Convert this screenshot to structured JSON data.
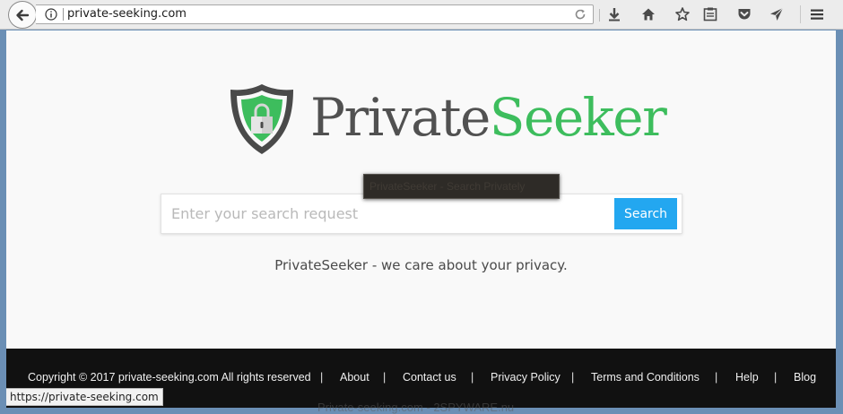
{
  "browser": {
    "url": "private-seeking.com",
    "toolbar_icons": [
      "download-icon",
      "home-icon",
      "bookmark-star-icon",
      "reader-view-icon",
      "pocket-icon",
      "send-icon",
      "menu-icon"
    ]
  },
  "logo": {
    "text_part1": "Private",
    "text_part2": "Seeker",
    "colors": {
      "shield_outline": "#4a4a4a",
      "shield_fill": "#3dbd5d",
      "private": "#515151",
      "seeker": "#3dbd5d"
    }
  },
  "tooltip": {
    "text": "PrivateSeeker - Search Privately"
  },
  "search": {
    "placeholder": "Enter your search request",
    "value": "",
    "button_label": "Search",
    "button_color": "#23a7f0"
  },
  "tagline": "PrivateSeeker - we care about your privacy.",
  "footer": {
    "copyright": "Copyright © 2017 private-seeking.com All rights reserved",
    "separator": "|",
    "links": [
      "About",
      "Contact us",
      "Privacy Policy",
      "Terms and Conditions",
      "Help",
      "Blog"
    ]
  },
  "status_bar": {
    "text": "https://private-seeking.com"
  },
  "watermark": "Private-seeking.com - 2SPYWARE.nu"
}
